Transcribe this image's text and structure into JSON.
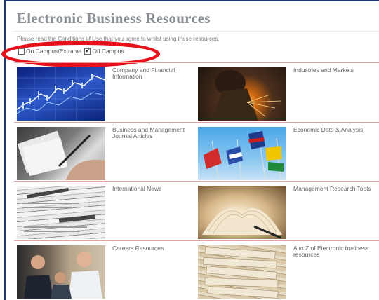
{
  "header": {
    "title": "Electronic Business Resources",
    "conditions_prefix": "Please read the ",
    "conditions_link": "Conditions of Use",
    "conditions_suffix": " that you agree to whilst using these resources."
  },
  "access": {
    "on_campus_label": "On Campus/Extranet",
    "on_campus_checked": false,
    "off_campus_label": "Off Campus",
    "off_campus_checked": true,
    "checkmark": "✔"
  },
  "annotation": {
    "color": "#e8101b"
  },
  "resources": [
    {
      "label": "Company and Financial Information",
      "thumb": "stock-chart-image"
    },
    {
      "label": "Industries and Markets",
      "thumb": "welder-image"
    },
    {
      "label": "Business and Management Journal Articles",
      "thumb": "writing-pen-image"
    },
    {
      "label": "Economic Data & Analysis",
      "thumb": "flags-image"
    },
    {
      "label": "International News",
      "thumb": "newspapers-image"
    },
    {
      "label": "Management Research Tools",
      "thumb": "open-book-image"
    },
    {
      "label": "Careers Resources",
      "thumb": "business-people-image"
    },
    {
      "label": "A to Z of Electronic business resources",
      "thumb": "file-folders-image"
    }
  ],
  "colors": {
    "frame": "#1f3a6e",
    "divider": "#e6a0a0",
    "title": "#8a8f96"
  }
}
